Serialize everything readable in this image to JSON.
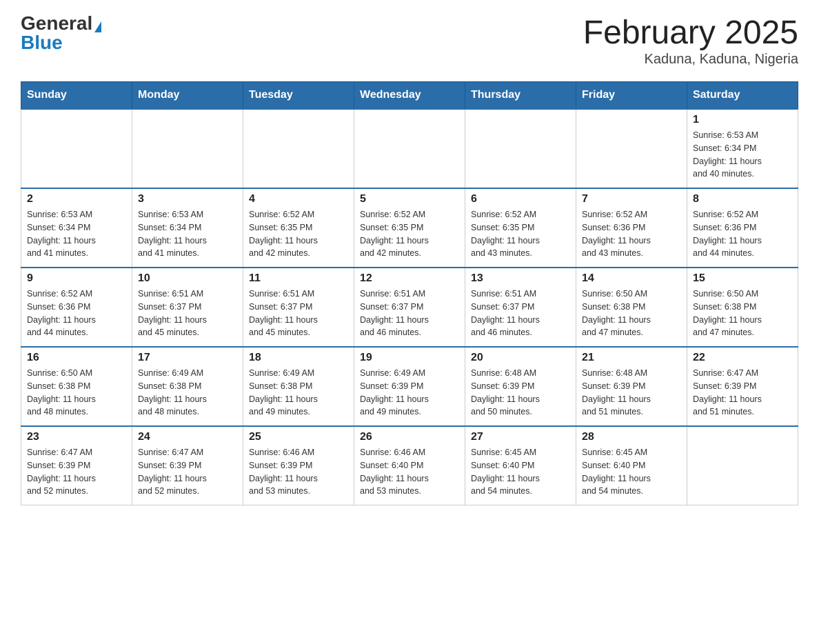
{
  "logo": {
    "general": "General",
    "blue": "Blue"
  },
  "header": {
    "month": "February 2025",
    "location": "Kaduna, Kaduna, Nigeria"
  },
  "weekdays": [
    "Sunday",
    "Monday",
    "Tuesday",
    "Wednesday",
    "Thursday",
    "Friday",
    "Saturday"
  ],
  "weeks": [
    [
      {
        "day": "",
        "info": ""
      },
      {
        "day": "",
        "info": ""
      },
      {
        "day": "",
        "info": ""
      },
      {
        "day": "",
        "info": ""
      },
      {
        "day": "",
        "info": ""
      },
      {
        "day": "",
        "info": ""
      },
      {
        "day": "1",
        "info": "Sunrise: 6:53 AM\nSunset: 6:34 PM\nDaylight: 11 hours\nand 40 minutes."
      }
    ],
    [
      {
        "day": "2",
        "info": "Sunrise: 6:53 AM\nSunset: 6:34 PM\nDaylight: 11 hours\nand 41 minutes."
      },
      {
        "day": "3",
        "info": "Sunrise: 6:53 AM\nSunset: 6:34 PM\nDaylight: 11 hours\nand 41 minutes."
      },
      {
        "day": "4",
        "info": "Sunrise: 6:52 AM\nSunset: 6:35 PM\nDaylight: 11 hours\nand 42 minutes."
      },
      {
        "day": "5",
        "info": "Sunrise: 6:52 AM\nSunset: 6:35 PM\nDaylight: 11 hours\nand 42 minutes."
      },
      {
        "day": "6",
        "info": "Sunrise: 6:52 AM\nSunset: 6:35 PM\nDaylight: 11 hours\nand 43 minutes."
      },
      {
        "day": "7",
        "info": "Sunrise: 6:52 AM\nSunset: 6:36 PM\nDaylight: 11 hours\nand 43 minutes."
      },
      {
        "day": "8",
        "info": "Sunrise: 6:52 AM\nSunset: 6:36 PM\nDaylight: 11 hours\nand 44 minutes."
      }
    ],
    [
      {
        "day": "9",
        "info": "Sunrise: 6:52 AM\nSunset: 6:36 PM\nDaylight: 11 hours\nand 44 minutes."
      },
      {
        "day": "10",
        "info": "Sunrise: 6:51 AM\nSunset: 6:37 PM\nDaylight: 11 hours\nand 45 minutes."
      },
      {
        "day": "11",
        "info": "Sunrise: 6:51 AM\nSunset: 6:37 PM\nDaylight: 11 hours\nand 45 minutes."
      },
      {
        "day": "12",
        "info": "Sunrise: 6:51 AM\nSunset: 6:37 PM\nDaylight: 11 hours\nand 46 minutes."
      },
      {
        "day": "13",
        "info": "Sunrise: 6:51 AM\nSunset: 6:37 PM\nDaylight: 11 hours\nand 46 minutes."
      },
      {
        "day": "14",
        "info": "Sunrise: 6:50 AM\nSunset: 6:38 PM\nDaylight: 11 hours\nand 47 minutes."
      },
      {
        "day": "15",
        "info": "Sunrise: 6:50 AM\nSunset: 6:38 PM\nDaylight: 11 hours\nand 47 minutes."
      }
    ],
    [
      {
        "day": "16",
        "info": "Sunrise: 6:50 AM\nSunset: 6:38 PM\nDaylight: 11 hours\nand 48 minutes."
      },
      {
        "day": "17",
        "info": "Sunrise: 6:49 AM\nSunset: 6:38 PM\nDaylight: 11 hours\nand 48 minutes."
      },
      {
        "day": "18",
        "info": "Sunrise: 6:49 AM\nSunset: 6:38 PM\nDaylight: 11 hours\nand 49 minutes."
      },
      {
        "day": "19",
        "info": "Sunrise: 6:49 AM\nSunset: 6:39 PM\nDaylight: 11 hours\nand 49 minutes."
      },
      {
        "day": "20",
        "info": "Sunrise: 6:48 AM\nSunset: 6:39 PM\nDaylight: 11 hours\nand 50 minutes."
      },
      {
        "day": "21",
        "info": "Sunrise: 6:48 AM\nSunset: 6:39 PM\nDaylight: 11 hours\nand 51 minutes."
      },
      {
        "day": "22",
        "info": "Sunrise: 6:47 AM\nSunset: 6:39 PM\nDaylight: 11 hours\nand 51 minutes."
      }
    ],
    [
      {
        "day": "23",
        "info": "Sunrise: 6:47 AM\nSunset: 6:39 PM\nDaylight: 11 hours\nand 52 minutes."
      },
      {
        "day": "24",
        "info": "Sunrise: 6:47 AM\nSunset: 6:39 PM\nDaylight: 11 hours\nand 52 minutes."
      },
      {
        "day": "25",
        "info": "Sunrise: 6:46 AM\nSunset: 6:39 PM\nDaylight: 11 hours\nand 53 minutes."
      },
      {
        "day": "26",
        "info": "Sunrise: 6:46 AM\nSunset: 6:40 PM\nDaylight: 11 hours\nand 53 minutes."
      },
      {
        "day": "27",
        "info": "Sunrise: 6:45 AM\nSunset: 6:40 PM\nDaylight: 11 hours\nand 54 minutes."
      },
      {
        "day": "28",
        "info": "Sunrise: 6:45 AM\nSunset: 6:40 PM\nDaylight: 11 hours\nand 54 minutes."
      },
      {
        "day": "",
        "info": ""
      }
    ]
  ]
}
